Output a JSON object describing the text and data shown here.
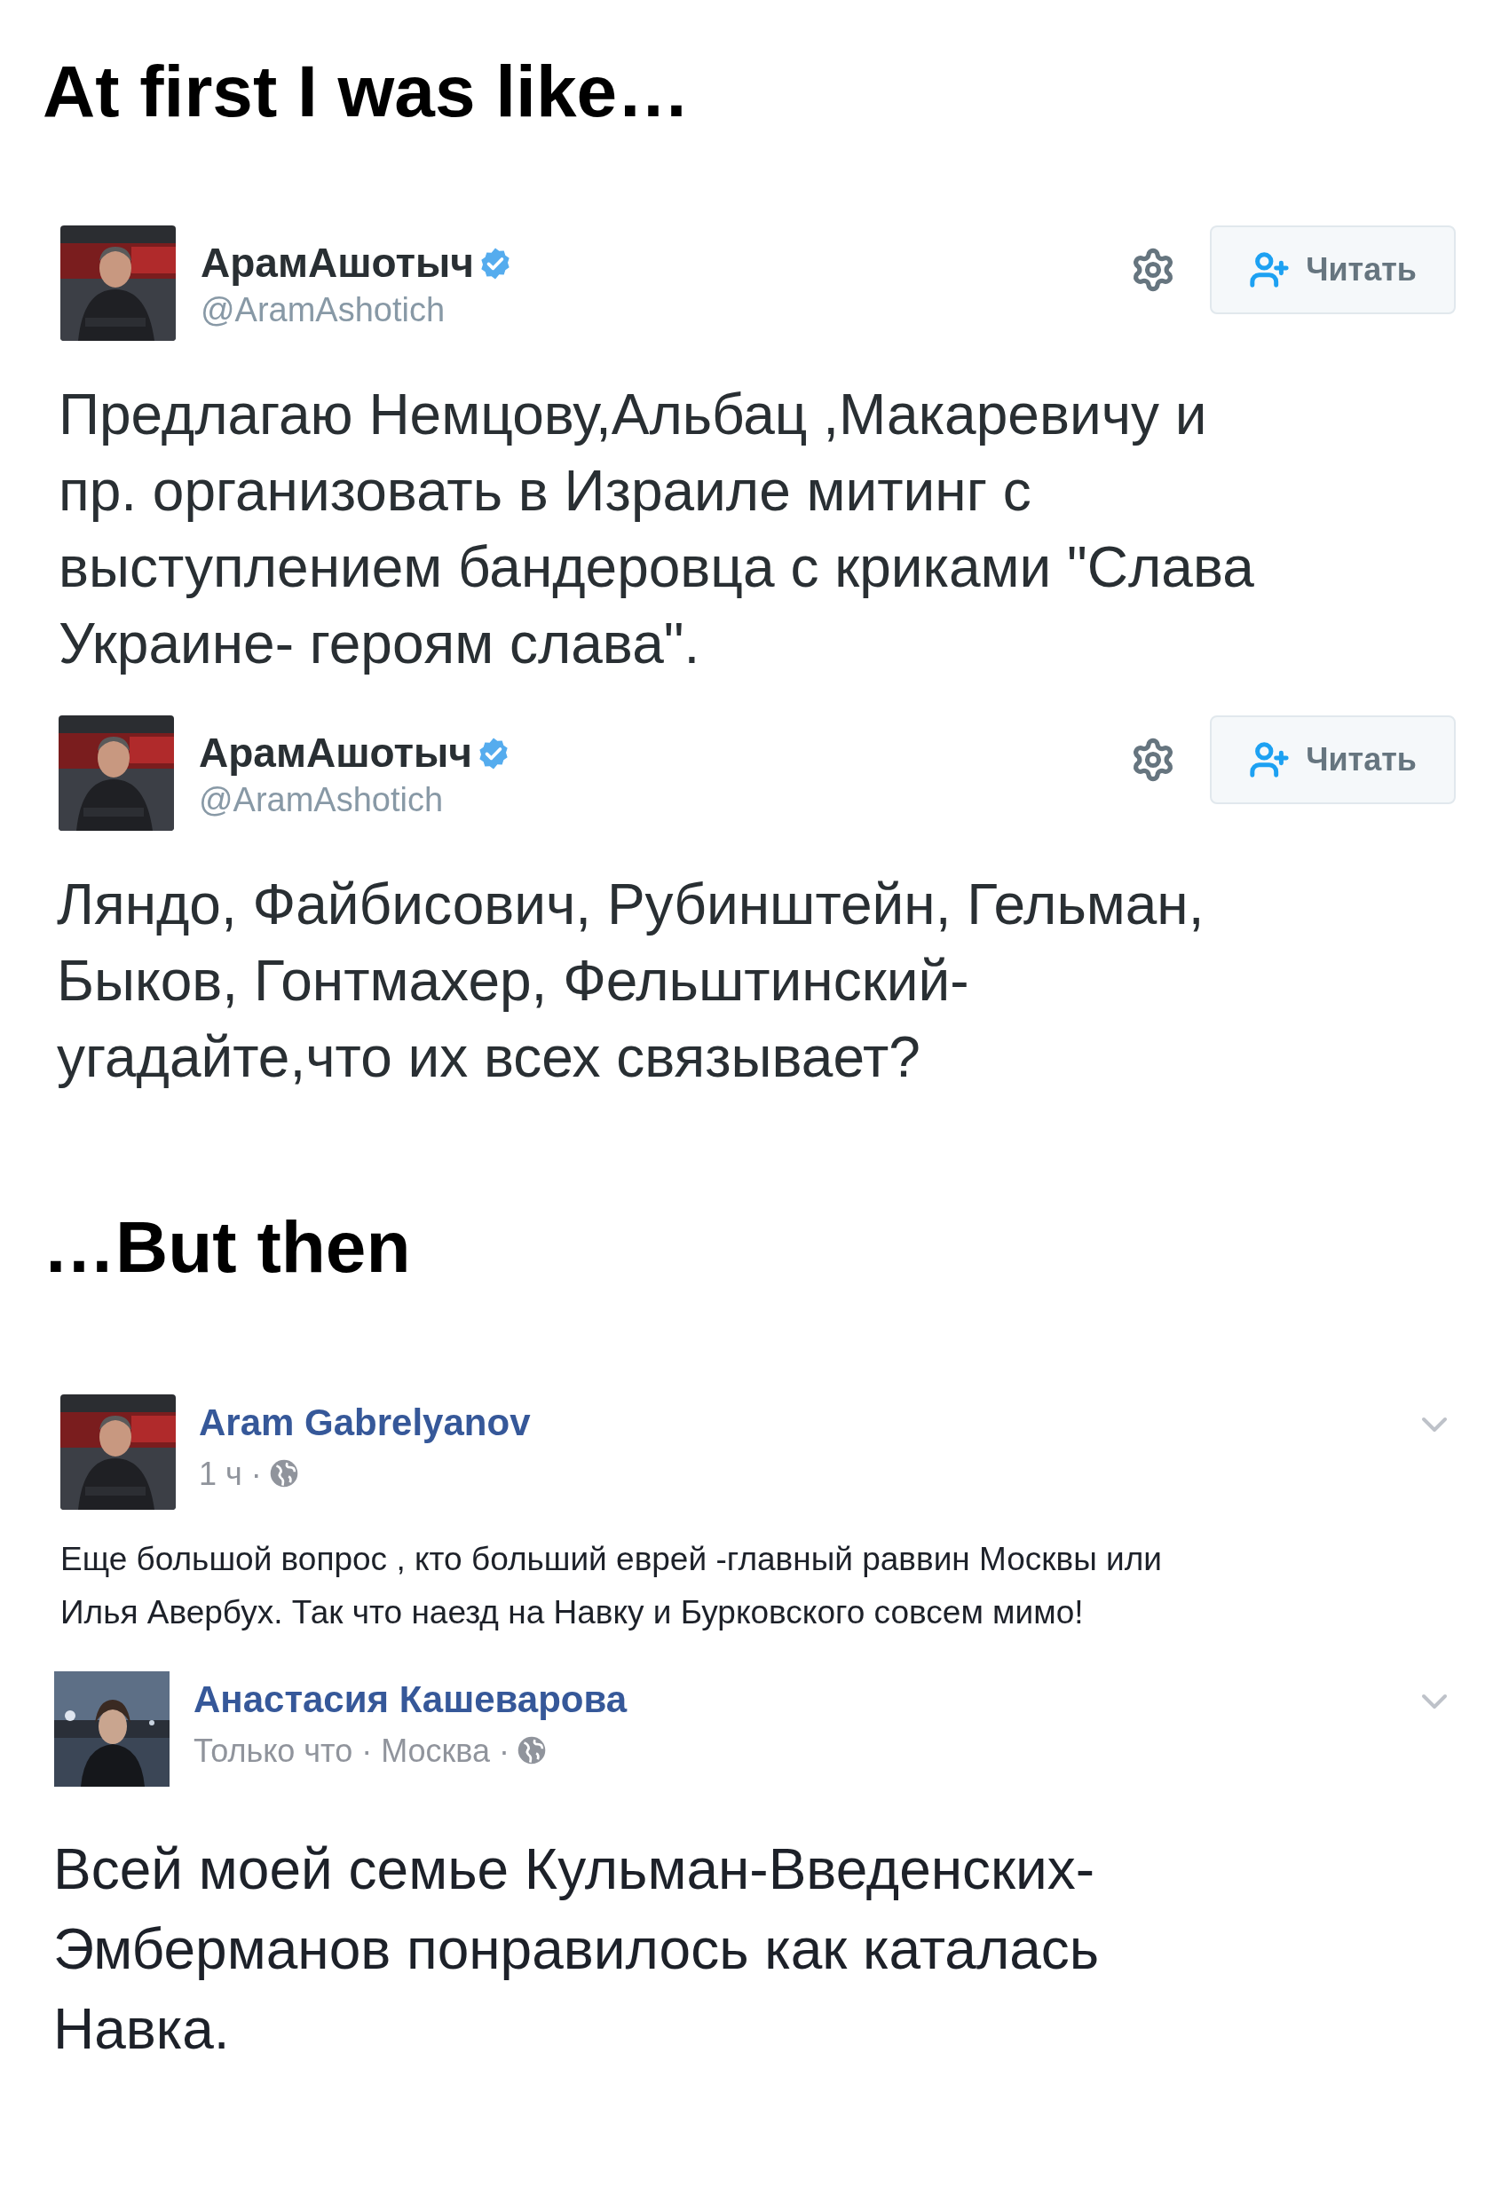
{
  "top_heading": "At first I was like…",
  "tweets": [
    {
      "name": "АрамАшотыч",
      "verified": true,
      "handle": "@AramAshotich",
      "follow_button": "Читать",
      "text": "Предлагаю Немцову,Альбац ,Макаревичу и\nпр. организовать в Израиле митинг с\nвыступлением бандеровца с криками \"Слава\nУкраине- героям слава\"."
    },
    {
      "name": "АрамАшотыч",
      "verified": true,
      "handle": "@AramAshotich",
      "follow_button": "Читать",
      "text": "Ляндо, Файбисович, Рубинштейн, Гельман,\nБыков, Гонтмахер, Фельштинский-\nугадайте,что их всех связывает?"
    }
  ],
  "bottom_heading": "…But then",
  "posts": [
    {
      "kind": "regular",
      "name": "Aram Gabrelyanov",
      "meta": "1 ч ·",
      "text": "Еще большой вопрос , кто больший еврей -главный раввин Москвы или\nИлья Авербух. Так что наезд на Навку и Бурковского совсем мимо!"
    },
    {
      "kind": "large",
      "name": "Анастасия Кашеварова",
      "meta": "Только что · Москва ·",
      "text": "Всей моей семье Кульман-Введенских-\nЭмберманов понравилось как каталась\nНавка."
    }
  ]
}
